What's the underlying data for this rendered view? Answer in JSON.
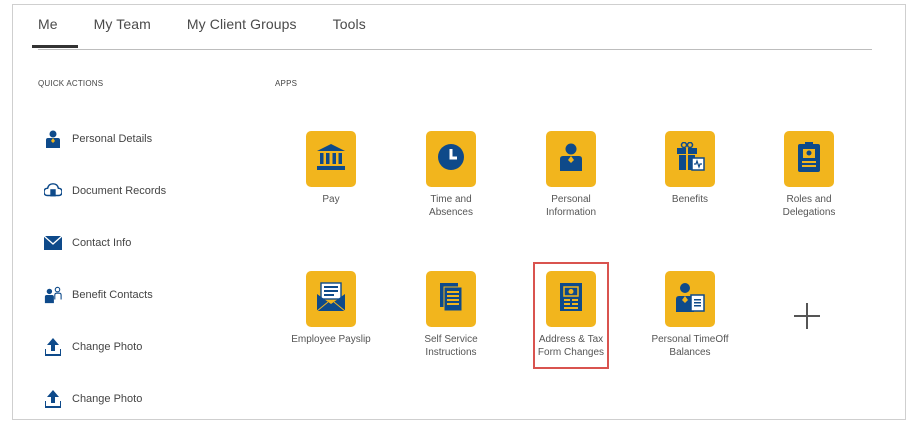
{
  "tabs": [
    {
      "label": "Me",
      "active": true
    },
    {
      "label": "My Team"
    },
    {
      "label": "My Client Groups"
    },
    {
      "label": "Tools"
    }
  ],
  "quick_actions": {
    "heading": "QUICK ACTIONS",
    "items": [
      {
        "label": "Personal Details",
        "icon": "person-icon"
      },
      {
        "label": "Document Records",
        "icon": "document-cloud-icon"
      },
      {
        "label": "Contact Info",
        "icon": "envelope-icon"
      },
      {
        "label": "Benefit Contacts",
        "icon": "people-icon"
      },
      {
        "label": "Change Photo",
        "icon": "upload-icon"
      },
      {
        "label": "Change Photo",
        "icon": "upload-icon"
      }
    ]
  },
  "apps": {
    "heading": "APPS",
    "items": [
      {
        "label": "Pay",
        "icon": "bank-icon"
      },
      {
        "label": "Time and\nAbsences",
        "icon": "clock-icon"
      },
      {
        "label": "Personal\nInformation",
        "icon": "person-icon"
      },
      {
        "label": "Benefits",
        "icon": "gift-icon"
      },
      {
        "label": "Roles and\nDelegations",
        "icon": "badge-icon"
      },
      {
        "label": "Employee Payslip",
        "icon": "envelope-payslip-icon"
      },
      {
        "label": "Self Service\nInstructions",
        "icon": "pages-icon"
      },
      {
        "label": "Address & Tax\nForm Changes",
        "icon": "tax-form-icon",
        "highlighted": true
      },
      {
        "label": "Personal TimeOff\nBalances",
        "icon": "person-document-icon"
      }
    ]
  },
  "colors": {
    "tile": "#f2b51d",
    "icon_blue": "#0e4a8a",
    "highlight": "#d9534f"
  }
}
